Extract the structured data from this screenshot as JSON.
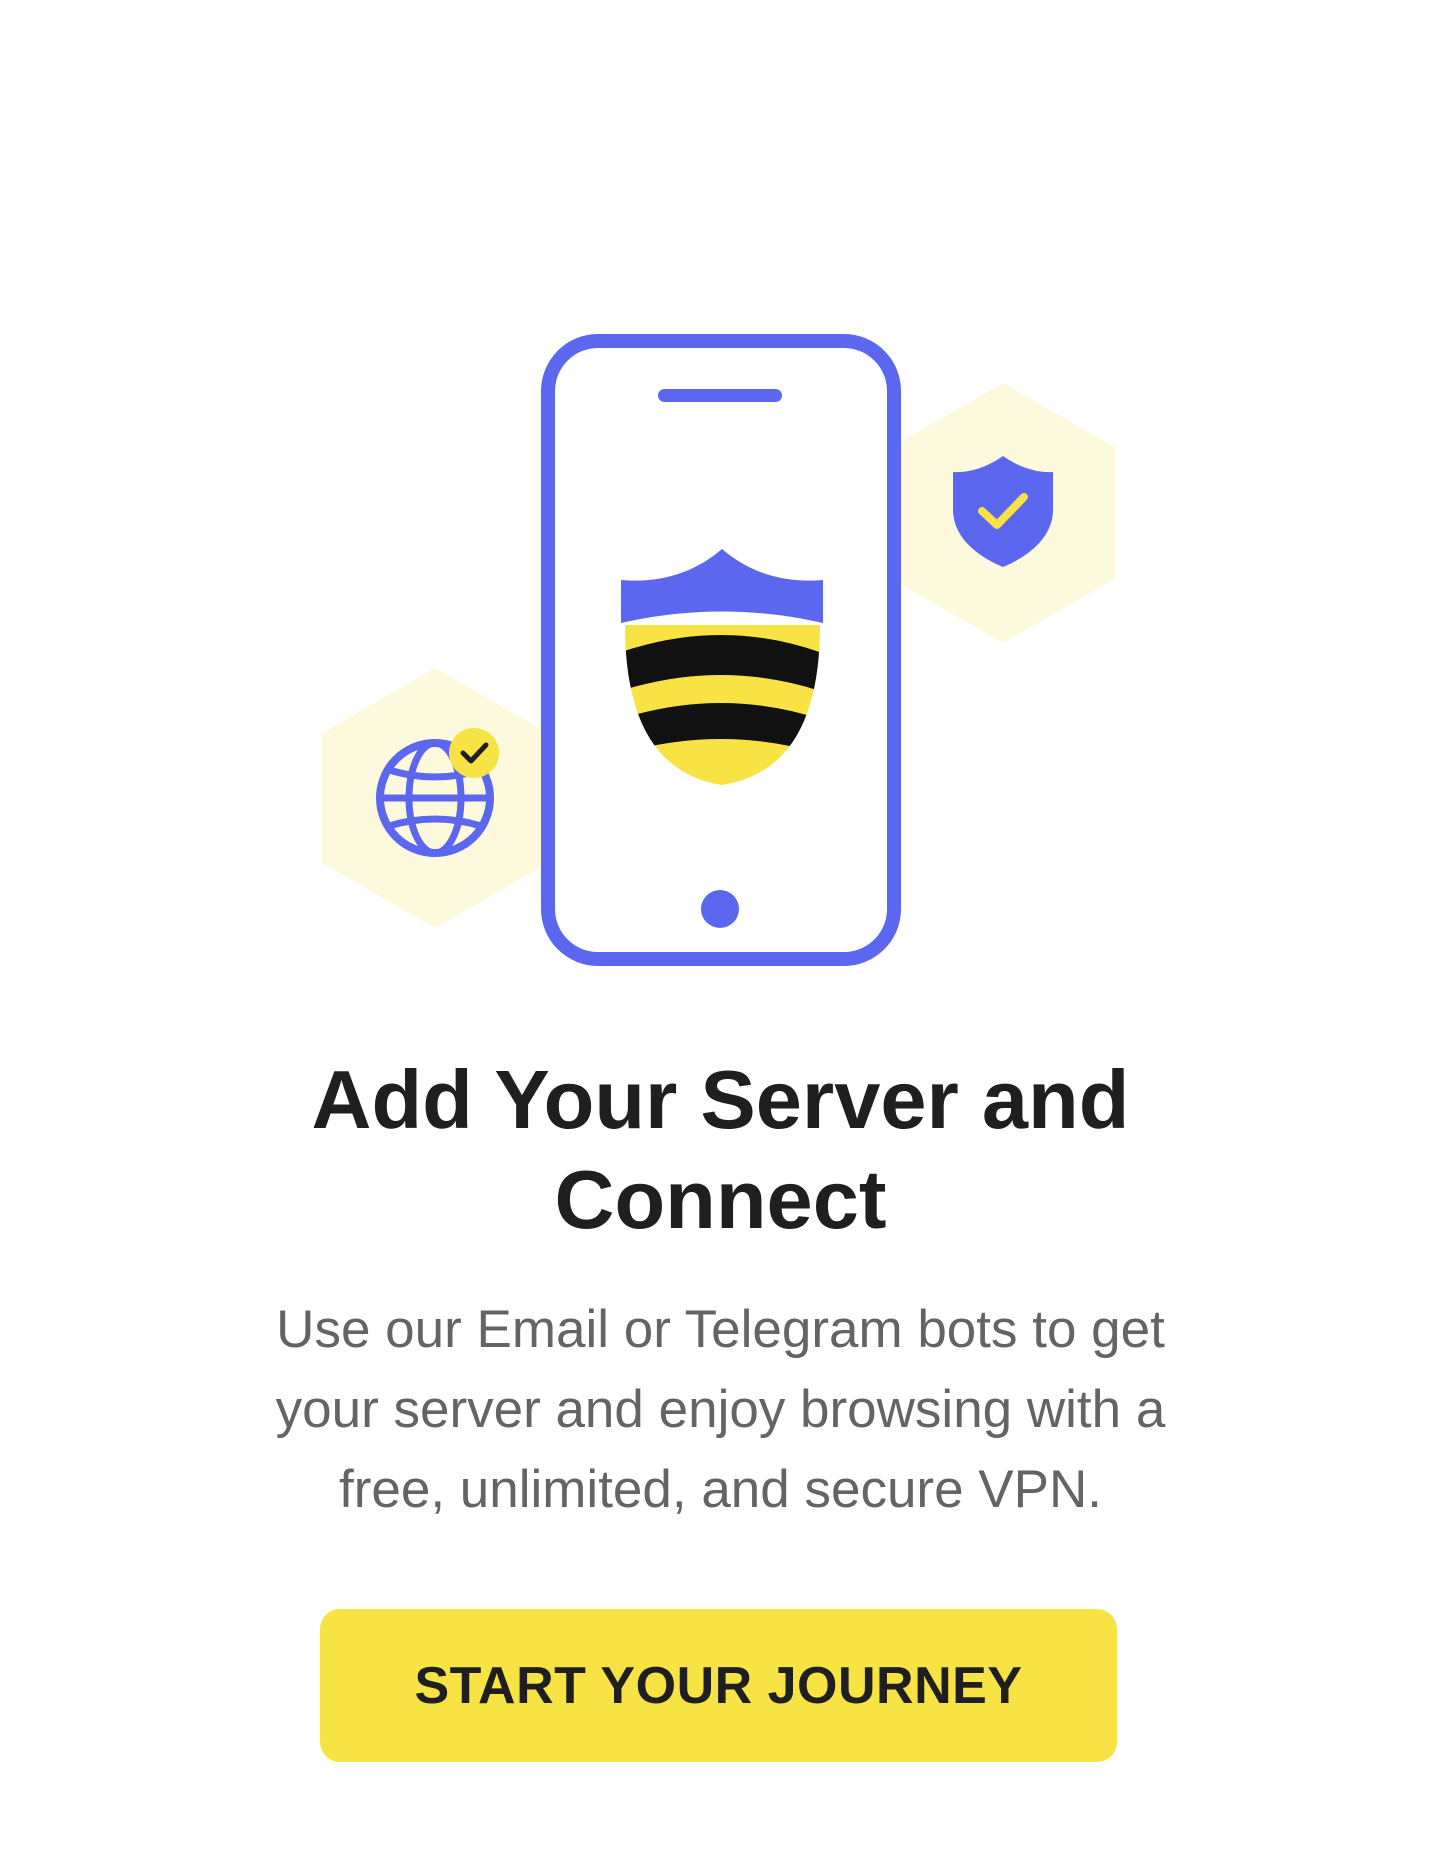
{
  "onboarding": {
    "title_line1": "Add Your Server and",
    "title_line2": "Connect",
    "description_line1": "Use our Email or Telegram bots to get",
    "description_line2": "your server and enjoy browsing with a",
    "description_line3": "free, unlimited, and secure VPN.",
    "cta_label": "START YOUR JOURNEY"
  },
  "illustration": {
    "icons": [
      "phone-icon",
      "vpn-shield-logo-icon",
      "shield-check-icon",
      "globe-check-icon"
    ]
  },
  "colors": {
    "accent_blue": "#5b67ee",
    "accent_yellow": "#f8e344",
    "hexagon_fill": "#fdf9dd",
    "title_text": "#1f1f1f",
    "body_text": "#646464",
    "background": "#ffffff"
  }
}
